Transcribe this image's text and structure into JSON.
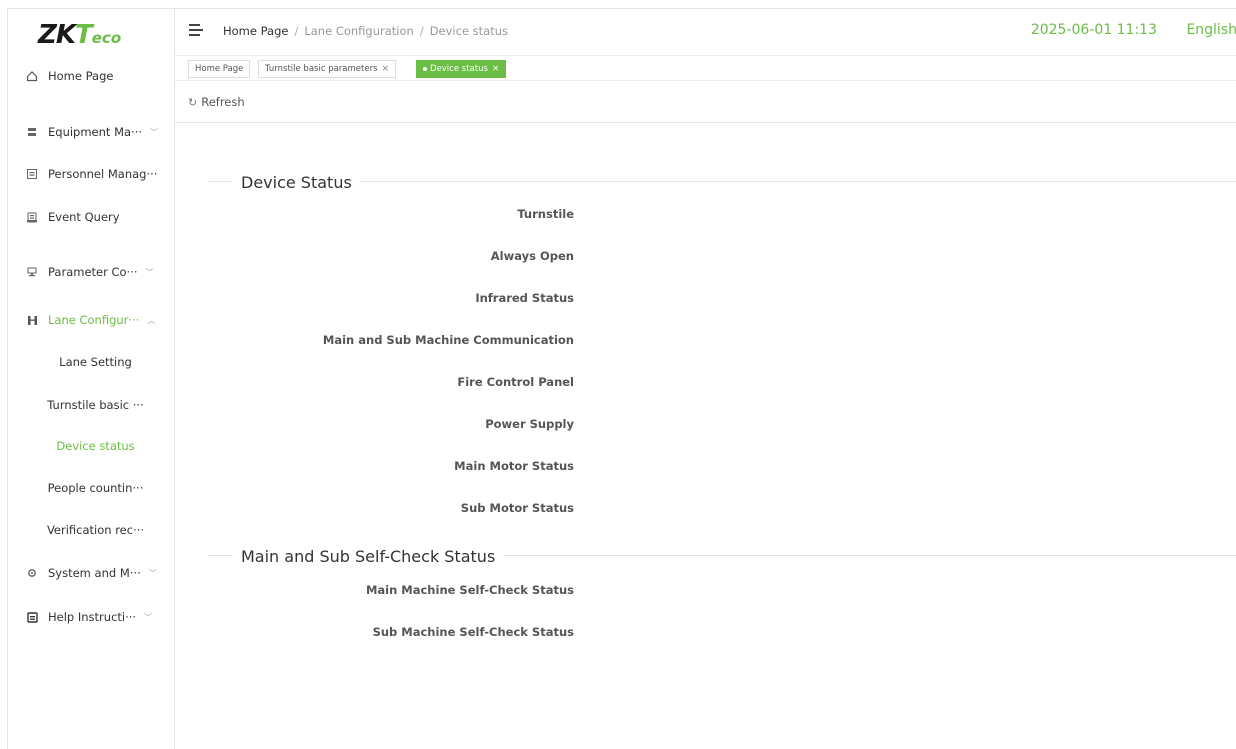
{
  "app": {
    "logo_zk": "ZK",
    "logo_t": "T",
    "logo_eco": "eco"
  },
  "sidebar": {
    "items": [
      {
        "label": "Home Page",
        "icon": "home-icon"
      },
      {
        "label": "Equipment Ma···",
        "icon": "equipment-icon",
        "chevron": "﹀"
      },
      {
        "label": "Personnel Manag···",
        "icon": "personnel-icon"
      },
      {
        "label": "Event Query",
        "icon": "event-icon"
      },
      {
        "label": "Parameter Co···",
        "icon": "parameter-icon",
        "chevron": "﹀"
      },
      {
        "label": "Lane Configur···",
        "icon": "lane-icon",
        "chevron": "︿"
      },
      {
        "label": "System and M···",
        "icon": "system-gear-icon",
        "chevron": "﹀"
      },
      {
        "label": "Help Instructi···",
        "icon": "help-book-icon",
        "chevron": "﹀"
      }
    ],
    "subitems": [
      {
        "label": "Lane Setting"
      },
      {
        "label": "Turnstile basic ···"
      },
      {
        "label": "Device status"
      },
      {
        "label": "People countin···"
      },
      {
        "label": "Verification rec···"
      }
    ]
  },
  "header": {
    "breadcrumb": [
      "Home Page",
      "Lane Configuration",
      "Device status"
    ],
    "breadcrumb_sep": "/",
    "datetime": "2025-06-01 11:13",
    "language": "English"
  },
  "tabs": [
    {
      "label": "Home Page"
    },
    {
      "label": "Turnstile basic parameters",
      "close": "×"
    },
    {
      "label": "Device status",
      "close": "×"
    }
  ],
  "toolbar": {
    "refresh_label": "Refresh",
    "refresh_icon": "↻"
  },
  "sections": [
    {
      "title": "Device Status",
      "fields": [
        "Turnstile",
        "Always Open",
        "Infrared Status",
        "Main and Sub Machine Communication",
        "Fire Control Panel",
        "Power Supply",
        "Main Motor Status",
        "Sub Motor Status"
      ]
    },
    {
      "title": "Main and Sub Self-Check Status",
      "fields": [
        "Main Machine Self-Check Status",
        "Sub Machine Self-Check Status"
      ]
    }
  ],
  "colors": {
    "accent": "#6cbd45",
    "text": "#333333",
    "muted": "#999999"
  }
}
